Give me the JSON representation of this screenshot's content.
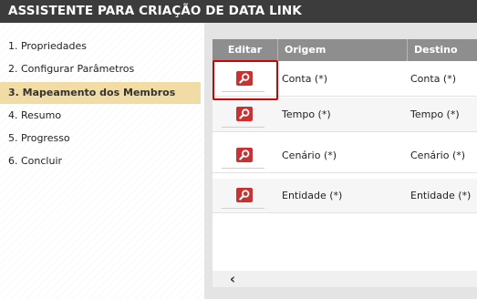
{
  "window": {
    "title": "ASSISTENTE PARA CRIAÇÃO DE DATA LINK"
  },
  "steps": [
    {
      "label": "1. Propriedades"
    },
    {
      "label": "2. Configurar Parâmetros"
    },
    {
      "label": "3. Mapeamento dos Membros"
    },
    {
      "label": "4. Resumo"
    },
    {
      "label": "5. Progresso"
    },
    {
      "label": "6. Concluir"
    }
  ],
  "active_step": "3. Mapeamento dos Membros",
  "grid": {
    "columns": [
      "Editar",
      "Origem",
      "Destino"
    ],
    "rows": [
      {
        "origem": "Conta (*)",
        "destino": "Conta (*)"
      },
      {
        "origem": "Tempo (*)",
        "destino": "Tempo (*)"
      },
      {
        "origem": "Cenário (*)",
        "destino": "Cenário (*)"
      },
      {
        "origem": "Entidade (*)",
        "destino": "Entidade (*)"
      }
    ],
    "edit_icon": "magnifier-icon",
    "focused_row": "Conta (*)"
  },
  "scrollbar": {
    "left_arrow": "‹"
  },
  "colors": {
    "titlebar": "#3c3c3c",
    "active_step": "#f1dca6",
    "header": "#8e8e8e",
    "edit_button": "#c83232",
    "focus": "#d40000"
  }
}
